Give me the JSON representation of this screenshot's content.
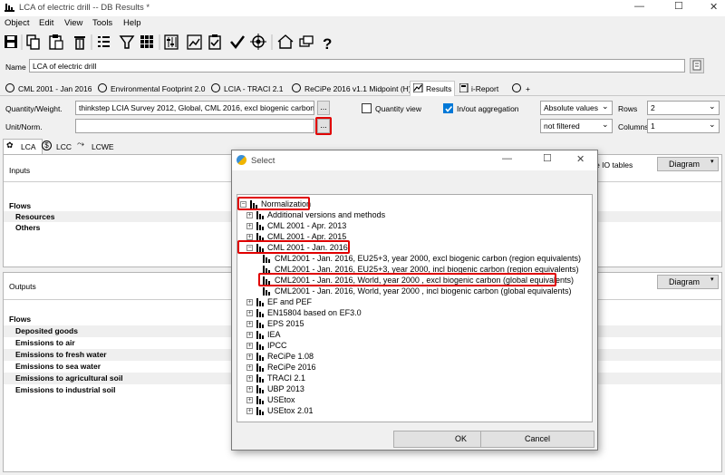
{
  "window": {
    "title": "LCA of electric drill -- DB Results *",
    "min": "—",
    "max": "☐",
    "close": "✕"
  },
  "menu": [
    "Object",
    "Edit",
    "View",
    "Tools",
    "Help"
  ],
  "name": {
    "label": "Name",
    "value": "LCA of electric drill"
  },
  "tabs": [
    "CML 2001 - Jan 2016",
    "Environmental Footprint 2.0",
    "LCIA - TRACI 2.1",
    "ReCiPe 2016 v1.1 Midpoint (H)",
    "Results",
    "i-Report",
    "+"
  ],
  "quantity": {
    "label": "Quantity/Weight.",
    "value": "thinkstep LCIA Survey 2012, Global, CML 2016, excl biogenic carbon (glo",
    "browse": "..."
  },
  "unit": {
    "label": "Unit/Norm.",
    "value": "",
    "browse": "..."
  },
  "quantity_view": {
    "label": "Quantity view",
    "checked": false
  },
  "inout": {
    "label": "In/out aggregation",
    "checked": true
  },
  "value_mode": {
    "selected": "Absolute values"
  },
  "filter": {
    "selected": "not filtered"
  },
  "rows": {
    "label": "Rows",
    "value": "2"
  },
  "columns": {
    "label": "Columns",
    "value": "1"
  },
  "subtabs": [
    "LCA",
    "LCC",
    "LCWE"
  ],
  "inputs": {
    "header": "Inputs",
    "rows": [
      "Flows",
      "Resources",
      "Others"
    ]
  },
  "outputs": {
    "header": "Outputs",
    "rows": [
      "Flows",
      "Deposited goods",
      "Emissions to air",
      "Emissions to fresh water",
      "Emissions to sea water",
      "Emissions to agricultural soil",
      "Emissions to industrial soil"
    ]
  },
  "right_panel": {
    "io_tables": "ate IO tables",
    "diagram": "Diagram",
    "diagram2": "Diagram"
  },
  "dialog": {
    "title": "Select",
    "ok": "OK",
    "cancel": "Cancel",
    "tree": [
      {
        "label": "Normalization",
        "level": 0,
        "toggle": "−"
      },
      {
        "label": "Additional versions and methods",
        "level": 1,
        "toggle": "+"
      },
      {
        "label": "CML 2001 - Apr. 2013",
        "level": 1,
        "toggle": "+"
      },
      {
        "label": "CML 2001 - Apr. 2015",
        "level": 1,
        "toggle": "+"
      },
      {
        "label": "CML 2001 - Jan. 2016",
        "level": 1,
        "toggle": "−"
      },
      {
        "label": "CML2001 - Jan. 2016, EU25+3, year 2000, excl biogenic carbon (region equivalents)",
        "level": 2,
        "toggle": ""
      },
      {
        "label": "CML2001 - Jan. 2016, EU25+3, year 2000, incl biogenic carbon (region equivalents)",
        "level": 2,
        "toggle": ""
      },
      {
        "label": "CML2001 - Jan. 2016, World, year 2000 , excl biogenic carbon (global equivalents)",
        "level": 2,
        "toggle": ""
      },
      {
        "label": "CML2001 - Jan. 2016, World, year 2000 , incl biogenic carbon (global equivalents)",
        "level": 2,
        "toggle": ""
      },
      {
        "label": "EF and PEF",
        "level": 1,
        "toggle": "+"
      },
      {
        "label": "EN15804 based on EF3.0",
        "level": 1,
        "toggle": "+"
      },
      {
        "label": "EPS 2015",
        "level": 1,
        "toggle": "+"
      },
      {
        "label": "IEA",
        "level": 1,
        "toggle": "+"
      },
      {
        "label": "IPCC",
        "level": 1,
        "toggle": "+"
      },
      {
        "label": "ReCiPe 1.08",
        "level": 1,
        "toggle": "+"
      },
      {
        "label": "ReCiPe 2016",
        "level": 1,
        "toggle": "+"
      },
      {
        "label": "TRACI 2.1",
        "level": 1,
        "toggle": "+"
      },
      {
        "label": "UBP 2013",
        "level": 1,
        "toggle": "+"
      },
      {
        "label": "USEtox",
        "level": 1,
        "toggle": "+"
      },
      {
        "label": "USEtox 2.01",
        "level": 1,
        "toggle": "+"
      }
    ]
  },
  "colors": {
    "highlight": "#e00000",
    "selection": "#0078d7"
  }
}
